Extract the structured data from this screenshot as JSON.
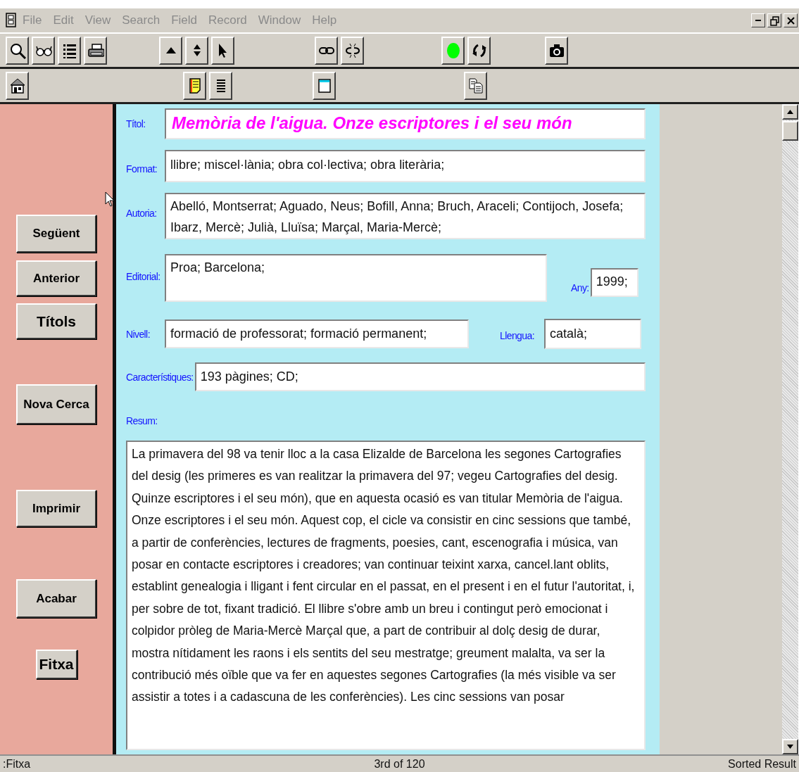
{
  "menu": [
    "File",
    "Edit",
    "View",
    "Search",
    "Field",
    "Record",
    "Window",
    "Help"
  ],
  "sidebar": {
    "buttons": [
      "Següent",
      "Anterior",
      "Títols",
      "Nova Cerca",
      "Imprimir",
      "Acabar",
      "Fitxa"
    ]
  },
  "record": {
    "title": {
      "label": "Títol:",
      "value": "Memòria de l'aigua. Onze escriptores i el seu món"
    },
    "format": {
      "label": "Format:",
      "value": "llibre; miscel·lània; obra col·lectiva; obra literària;"
    },
    "authors": {
      "label": "Autoria:",
      "value": "Abelló, Montserrat; Aguado, Neus; Bofill, Anna; Bruch, Araceli; Contijoch, Josefa; Ibarz, Mercè; Julià, Lluïsa; Marçal, Maria-Mercè;"
    },
    "publisher": {
      "label": "Editorial:",
      "value": "Proa; Barcelona;"
    },
    "year": {
      "label": "Any:",
      "value": "1999;"
    },
    "level": {
      "label": "Nivell:",
      "value": "formació de professorat; formació permanent;"
    },
    "language": {
      "label": "Llengua:",
      "value": "català;"
    },
    "features": {
      "label": "Característiques:",
      "value": "193 pàgines; CD;"
    },
    "summary": {
      "label": "Resum:",
      "value": "La primavera del 98 va tenir lloc a la casa Elizalde de Barcelona les segones Cartografies del desig (les primeres es van realitzar la primavera del 97; vegeu Cartografies del desig. Quinze escriptores i el seu món), que en aquesta ocasió es van titular Memòria de l'aigua. Onze escriptores i el seu món. Aquest cop, el cicle va consistir en cinc sessions que també, a partir de conferències, lectures de fragments, poesies, cant, escenografia i música, van posar en contacte escriptores i creadores; van continuar teixint xarxa, cancel.lant oblits, establint genealogia i lligant i fent circular en el passat, en el present i en el futur l'autoritat, i, per sobre de tot, fixant tradició. El llibre s'obre amb un breu i contingut però emocionat i colpidor pròleg de Maria-Mercè Marçal que, a part de contribuir al dolç desig de durar, mostra nítidament les raons i els sentits del seu mestratge; greument malalta, va ser la contribució més oïble que va fer en aquestes segones Cartografies (la més visible va ser assistir a totes i a cadascuna de les conferències). Les cinc sessions van posar"
    }
  },
  "status_bar": {
    "left": ":Fitxa",
    "center": "3rd of 120",
    "right": "Sorted Result"
  }
}
